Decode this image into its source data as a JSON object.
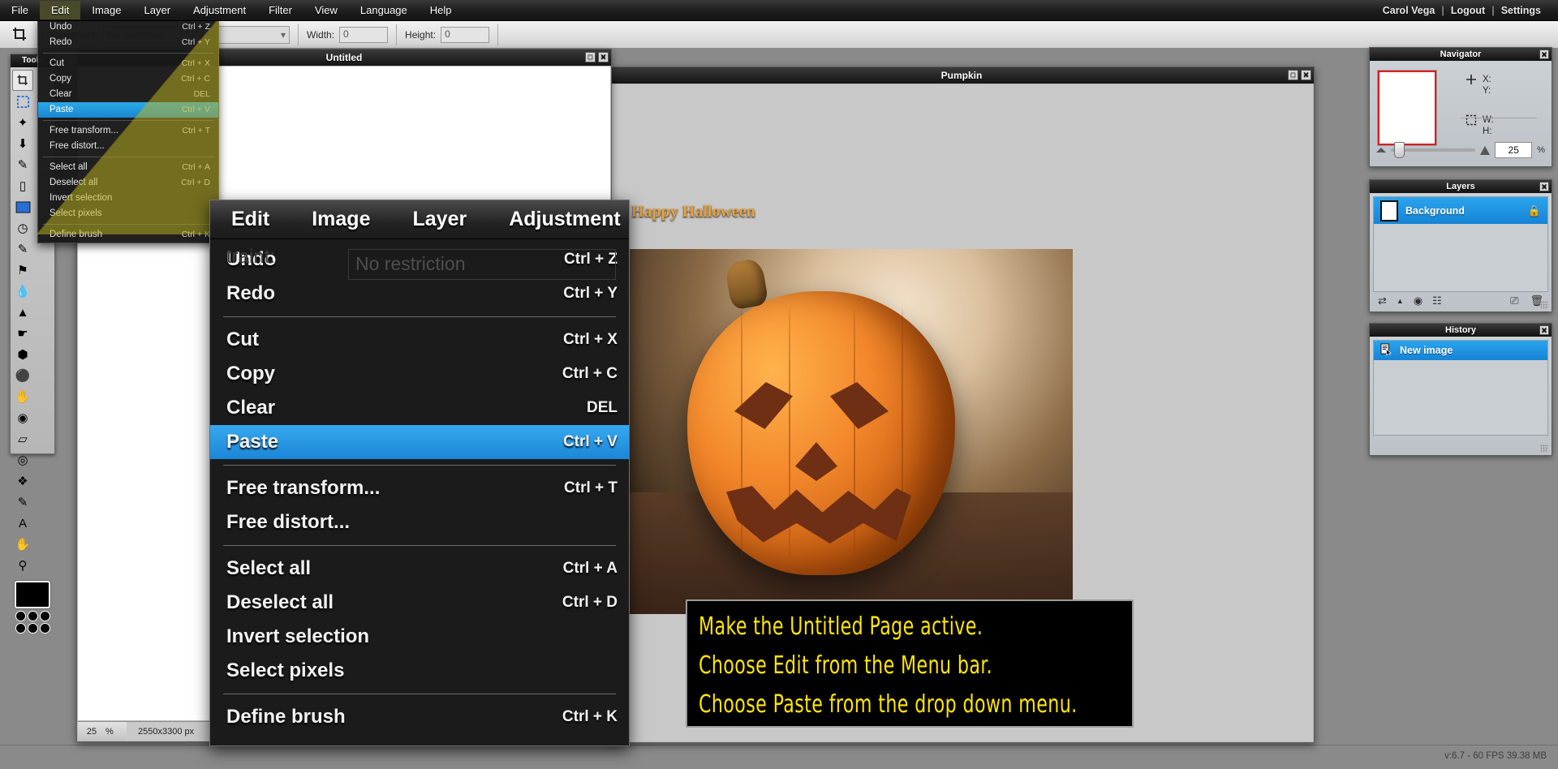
{
  "menubar": {
    "items": [
      "File",
      "Edit",
      "Image",
      "Layer",
      "Adjustment",
      "Filter",
      "View",
      "Language",
      "Help"
    ],
    "active_item": "Edit",
    "user": "Carol Vega",
    "logout": "Logout",
    "settings": "Settings",
    "separator": "|"
  },
  "options_bar": {
    "tool_icon": "crop-icon",
    "constraint_label": "Constraint:",
    "constraint_value": "No restriction",
    "width_label": "Width:",
    "width_value": "0",
    "height_label": "Height:",
    "height_value": "0"
  },
  "toolbox": {
    "title": "Tools",
    "tools": [
      {
        "name": "crop-tool",
        "glyph": "⛶",
        "selected": true
      },
      {
        "name": "marquee-select-tool",
        "glyph": "⬚",
        "selected": false
      },
      {
        "name": "magic-wand-tool",
        "glyph": "✨",
        "selected": false
      },
      {
        "name": "lasso-tool",
        "glyph": "➰",
        "selected": false
      },
      {
        "name": "pencil-tool",
        "glyph": "✏",
        "selected": false
      },
      {
        "name": "eraser-tool",
        "glyph": "▭",
        "selected": false
      },
      {
        "name": "paint-bucket-tool",
        "glyph": "■",
        "selected": false
      },
      {
        "name": "gradient-tool",
        "glyph": "◧",
        "selected": false
      },
      {
        "name": "brush-tool",
        "glyph": "✒",
        "selected": false
      },
      {
        "name": "clone-stamp-tool",
        "glyph": "⚑",
        "selected": false
      },
      {
        "name": "water-drop-blur-tool",
        "glyph": "●",
        "selected": false
      },
      {
        "name": "sharpen-tool",
        "glyph": "▲",
        "selected": false
      },
      {
        "name": "smudge-tool",
        "glyph": "☛",
        "selected": false
      },
      {
        "name": "sponge-tool",
        "glyph": "⬢",
        "selected": false
      },
      {
        "name": "dodge-tool",
        "glyph": "⚫",
        "selected": false
      },
      {
        "name": "burn-tool",
        "glyph": "✋",
        "selected": false
      },
      {
        "name": "red-eye-tool",
        "glyph": "◉",
        "selected": false
      },
      {
        "name": "pill-tool",
        "glyph": "▱",
        "selected": false
      },
      {
        "name": "bloat-tool",
        "glyph": "◎",
        "selected": false
      },
      {
        "name": "pinch-tool",
        "glyph": "❖",
        "selected": false
      },
      {
        "name": "eyedropper-tool",
        "glyph": "✒",
        "selected": false
      },
      {
        "name": "type-tool",
        "glyph": "A",
        "selected": false
      },
      {
        "name": "hand-tool",
        "glyph": "✋",
        "selected": false
      },
      {
        "name": "zoom-tool",
        "glyph": "⚲",
        "selected": false
      }
    ],
    "foreground_color": "#000000"
  },
  "edit_menu": {
    "groups": [
      [
        {
          "label": "Undo",
          "shortcut": "Ctrl + Z",
          "highlighted": false
        },
        {
          "label": "Redo",
          "shortcut": "Ctrl + Y",
          "highlighted": false
        }
      ],
      [
        {
          "label": "Cut",
          "shortcut": "Ctrl + X",
          "highlighted": false
        },
        {
          "label": "Copy",
          "shortcut": "Ctrl + C",
          "highlighted": false
        },
        {
          "label": "Clear",
          "shortcut": "DEL",
          "highlighted": false
        },
        {
          "label": "Paste",
          "shortcut": "Ctrl + V",
          "highlighted": true
        }
      ],
      [
        {
          "label": "Free transform...",
          "shortcut": "Ctrl + T",
          "highlighted": false
        },
        {
          "label": "Free distort...",
          "shortcut": "",
          "highlighted": false
        }
      ],
      [
        {
          "label": "Select all",
          "shortcut": "Ctrl + A",
          "highlighted": false
        },
        {
          "label": "Deselect all",
          "shortcut": "Ctrl + D",
          "highlighted": false
        },
        {
          "label": "Invert selection",
          "shortcut": "",
          "highlighted": false
        },
        {
          "label": "Select pixels",
          "shortcut": "",
          "highlighted": false
        }
      ],
      [
        {
          "label": "Define brush",
          "shortcut": "Ctrl + K",
          "highlighted": false
        }
      ]
    ]
  },
  "magnified_popup": {
    "menu_tabs": [
      "Edit",
      "Image",
      "Layer",
      "Adjustment"
    ],
    "ghost_label": "traint:",
    "ghost_value": "No restriction"
  },
  "windows": {
    "untitled": {
      "title": "Untitled",
      "zoom_value": "25",
      "zoom_unit": "%",
      "dimensions": "2550x3300 px",
      "minimize_glyph": "□",
      "close_glyph": "✕"
    },
    "pumpkin": {
      "title": "Pumpkin",
      "overlay_text": "Happy Halloween",
      "minimize_glyph": "□",
      "close_glyph": "✕"
    }
  },
  "instructions": {
    "lines": [
      "Make the Untitled Page active.",
      "Choose Edit from the Menu bar.",
      "Choose Paste from the drop down menu."
    ],
    "text_color": "#ffe600",
    "background_color": "#000000"
  },
  "navigator": {
    "title": "Navigator",
    "close_glyph": "✕",
    "x_label": "X:",
    "y_label": "Y:",
    "w_label": "W:",
    "h_label": "H:",
    "crosshair_icon": "crosshair-icon",
    "selection_icon": "selection-icon",
    "zoom_value": "25",
    "zoom_unit": "%"
  },
  "layers": {
    "title": "Layers",
    "close_glyph": "✕",
    "rows": [
      {
        "name": "Background",
        "locked": true,
        "selected": true
      }
    ],
    "footer_icons": [
      "blend-mode-icon",
      "caret-up-icon",
      "layer-style-icon",
      "new-adjustment-icon",
      "duplicate-layer-icon",
      "trash-icon"
    ],
    "lock_glyph": "🔒"
  },
  "history": {
    "title": "History",
    "close_glyph": "✕",
    "rows": [
      {
        "name": "New image",
        "selected": true
      }
    ],
    "item_icon": "document-pointer-icon"
  },
  "status": {
    "version_text": "v:6.7 - 60 FPS 39.38 MB"
  },
  "colors": {
    "accent_blue": "#1e8fe0",
    "highlight_olive": "#beb41e",
    "annotation_yellow": "#ffe600",
    "navigator_frame_red": "#e01b1b"
  }
}
